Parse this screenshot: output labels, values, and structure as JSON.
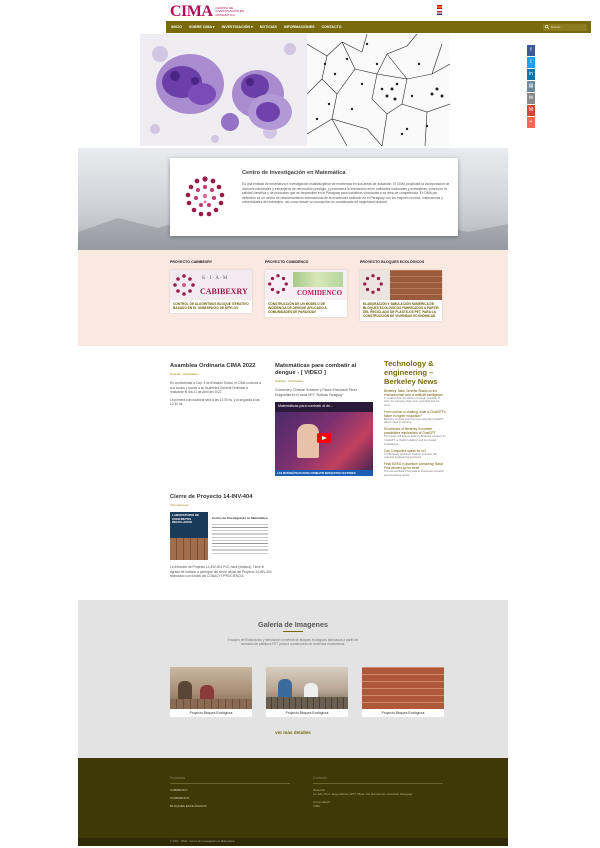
{
  "header": {
    "logo_mark": "CIMA",
    "logo_text": "CENTRO DE INVESTIGACIÓN EN MATEMÁTICA"
  },
  "nav": {
    "items": [
      "INICIO",
      "SOBRE CIMA ▾",
      "INVESTIGACIÓN ▾",
      "NOTICIAS",
      "INFORMACIONES",
      "CONTACTO"
    ],
    "search_placeholder": "Buscar..."
  },
  "share": {
    "icons": [
      "facebook-icon",
      "twitter-icon",
      "linkedin-icon",
      "print-icon",
      "email-icon",
      "gmail-icon",
      "more-icon"
    ],
    "colors": [
      "#3b5998",
      "#1da1f2",
      "#0e76a8",
      "#6d8a9c",
      "#8a8a8a",
      "#d44638",
      "#ff6550"
    ]
  },
  "about": {
    "title": "Centro de Investigación en Matemática",
    "text": "Es una entidad de enseñanza e investigación multidisciplinar de excelencia en sus áreas de actuación. El CIMA propiciará la incorporación de doctores nacionales y extranjeros de reconocido prestigio, y promoverá la interacción entre entidades nacionales y extranjeras; velará por la calidad científica y de productos que se desarrollen en el Paraguay para industrias vinculadas a su área de competencia. El CIMA por definición es un centro de relacionamiento internacional de la excelencia radicado en el Paraguay con los mejores centros, instituciones y universidades del extranjero, así como desde su concepción es considerado de seguridad nacional."
  },
  "projects": [
    {
      "heading": "PROYECTO CABIBEXRY",
      "image_text": "CABIBEXRY",
      "image_sub": "K · I · A · M",
      "caption": "CONTROL DE ALGORITMOS BLOQUE ITERATIVO BASADO EN EL SUBESPACIO DE KRYLOV"
    },
    {
      "heading": "PROYECTO COMIDENCO",
      "image_text": "COMIDENCO",
      "image_sub": "",
      "caption": "CONSTRUCCIÓN DE UN MODELO DE INCIDENCIA DE DENGUE APLICADO A COMUNIDADES DE PARAGUAY"
    },
    {
      "heading": "PROYECTO BLOQUES ECOLÓGICOS",
      "image_text": "",
      "image_sub": "",
      "caption": "ELABORACIÓN Y SIMULACIÓN NUMÉRICA DE BLOQUES ECOLÓGICOS FABRICADOS A PARTIR DEL RECICLADO DE PLÁSTICOS PET, PARA LA CONSTRUCCIÓN DE VIVIENDAS ECONÓMICAS"
    }
  ],
  "posts": {
    "post1": {
      "title": "Asamblea Ordinaria CIMA 2022",
      "meta": "Noticias · Resultados",
      "p1": "En conformidad a Cap. 9 del Estatuto Social, el CIMA convoca a sus socios y socias a su Asamblea General Ordinaria a realizarse el día 21 de Abril del 2022.",
      "p2": "La primera convocatoria será a las 12:00 hs. y la segunda a las 12:30 hs."
    },
    "post2": {
      "title": "Matemáticas para combatir al dengue - [ VIDEO ]",
      "meta": "Noticias · Resultados",
      "body": "Colmenita y Christian Schaerer y Pastor Emmanuel Pérez Estigarribia en el canal NPY \"Noticias Paraguay\"",
      "video_title": "Matemáticas para combatir al de...",
      "video_caption": "LAS MATEMÁTICAS PARA COMBATIR MOSQUITOS VECTORES"
    },
    "post3": {
      "title": "Cierre de Proyecto 14-INV-404",
      "meta": "Informaciones",
      "image_title": "LABORATORIO DE CONCRETOS RECICLADOS",
      "image_side_title": "Centro de Investigación en Matemática",
      "body": "La dirección de Proyecto 14-INV-404 PUC hace (elabora). Tiene el agrado de invitarlo a participar del cierre oficial del Proyecto 14-INV-404 financiado con fondos del CONACYT/PROCIENCIA."
    }
  },
  "news": {
    "title": "Technology & engineering – Berkeley News",
    "items": [
      {
        "link": "Berkeley Talks: Jennifer Bhalla on the environmental cost of artificial intelligence",
        "desc": "In a talk at Cal, the author on tough question of tech, the carrying costs of AI, and what can be done."
      },
      {
        "link": "From cat bar to chatting, what is ChatGPT's future in higher education?",
        "desc": "Berkeley experts examine how tools like ChatGPT will be used in learning."
      },
      {
        "link": "50 scholars of Berkeley in number possibilities implications of ChatGPT",
        "desc": "The series will feature talks by Berkeley scholars on ChatGPT, a chatbot platform and its broader implications."
      },
      {
        "link": "Can Computers speak for us?",
        "desc": "UC Berkeley professor Hyamin Antonian will examine engineering questions."
      },
      {
        "link": "Final 5G/6G in quantum computing: Basic Plus winners go for three",
        "desc": "The annual Basic Plus awards showcase research and innovative teams."
      }
    ]
  },
  "gallery": {
    "title": "Galería de Imagenes",
    "description": "Ensayos de Elaboración y simulación numérica de bloques ecológicos fabricados a partir del reciclado de plásticos PET para la construcción de viviendas económicas.",
    "items": [
      "Proyecto Bloques Ecológicos",
      "Proyecto Bloques Ecológicos",
      "Proyecto Bloques Ecológicos"
    ],
    "more": "ver más detalles"
  },
  "footer": {
    "col1_heading": "Proyectos",
    "col1_links": [
      "CABIBEXRY",
      "COMIDENCO",
      "BLOQUES ECOLÓGICOS"
    ],
    "col2_heading": "Contacto",
    "address_label": "Dirección",
    "address": "Av. Fdo. Prof. Jorge Alfonso 1877 / Bvar. Vía del Carmen, Asunción Paraguay",
    "email_label": "Correo Electr.",
    "email": "CIMA",
    "copyright": "© 2022 · CIMA · Centro de Investigación en Matemática"
  }
}
